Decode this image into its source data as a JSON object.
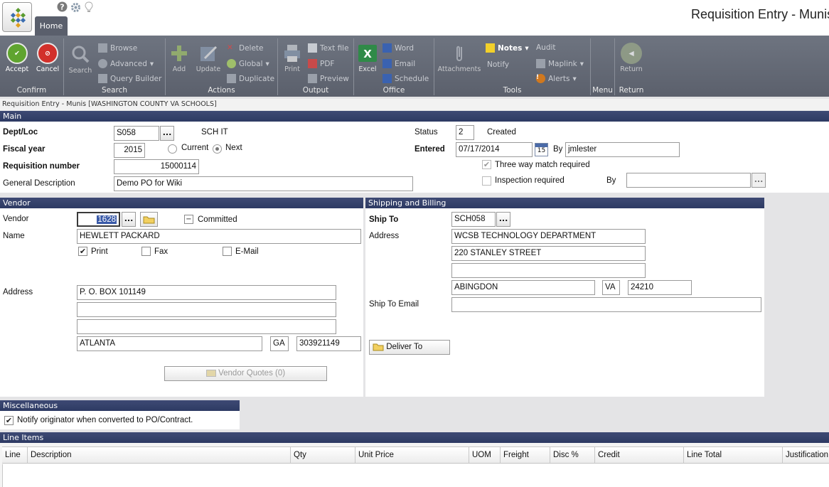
{
  "header": {
    "home_tab": "Home",
    "title": "Requisition Entry - Munis"
  },
  "ribbon": {
    "groups": [
      "Confirm",
      "Search",
      "Actions",
      "Output",
      "Office",
      "Tools",
      "Menu",
      "Return"
    ],
    "accept": "Accept",
    "cancel": "Cancel",
    "search": "Search",
    "browse": "Browse",
    "advanced": "Advanced",
    "query_builder": "Query Builder",
    "add": "Add",
    "update": "Update",
    "delete": "Delete",
    "global": "Global",
    "duplicate": "Duplicate",
    "print": "Print",
    "text_file": "Text file",
    "pdf": "PDF",
    "preview": "Preview",
    "excel": "Excel",
    "word": "Word",
    "email": "Email",
    "schedule": "Schedule",
    "attachments": "Attachments",
    "notes": "Notes",
    "notify": "Notify",
    "audit": "Audit",
    "maplink": "Maplink",
    "alerts": "Alerts",
    "return": "Return"
  },
  "breadcrumb": "Requisition Entry - Munis [WASHINGTON COUNTY VA SCHOOLS]",
  "main": {
    "title": "Main",
    "dept_loc_label": "Dept/Loc",
    "dept_loc_value": "S058",
    "dept_loc_desc": "SCH IT",
    "fiscal_year_label": "Fiscal year",
    "fiscal_year_value": "2015",
    "current_label": "Current",
    "next_label": "Next",
    "selected_year": "Next",
    "req_number_label": "Requisition number",
    "req_number_value": "15000114",
    "gen_desc_label": "General Description",
    "gen_desc_value": "Demo PO for Wiki",
    "status_label": "Status",
    "status_code": "2",
    "status_text": "Created",
    "entered_label": "Entered",
    "entered_date": "07/17/2014",
    "calendar_day": "15",
    "by_label": "By",
    "by_value": "jmlester",
    "three_way_label": "Three way match required",
    "three_way_checked": true,
    "inspection_label": "Inspection required",
    "inspection_checked": false,
    "inspection_by_label": "By",
    "inspection_by_value": ""
  },
  "vendor": {
    "title": "Vendor",
    "vendor_label": "Vendor",
    "vendor_value": "1628",
    "committed_label": "Committed",
    "name_label": "Name",
    "name_value": "HEWLETT PACKARD",
    "print_label": "Print",
    "print_checked": true,
    "fax_label": "Fax",
    "fax_checked": false,
    "email_label": "E-Mail",
    "email_checked": false,
    "address_label": "Address",
    "address1": "P. O. BOX 101149",
    "address2": "",
    "address3": "",
    "city": "ATLANTA",
    "state": "GA",
    "zip": "303921149",
    "quotes_button": "Vendor Quotes (0)"
  },
  "shipping": {
    "title": "Shipping and Billing",
    "ship_to_label": "Ship To",
    "ship_to_value": "SCH058",
    "address_label": "Address",
    "address1": "WCSB TECHNOLOGY DEPARTMENT",
    "address2": "220 STANLEY STREET",
    "address3": "",
    "city": "ABINGDON",
    "state": "VA",
    "zip": "24210",
    "email_label": "Ship To Email",
    "email_value": "",
    "deliver_button": "Deliver To"
  },
  "misc": {
    "title": "Miscellaneous",
    "notify_label": "Notify originator when converted to PO/Contract.",
    "notify_checked": true
  },
  "line_items": {
    "title": "Line Items",
    "columns": [
      "Line",
      "Description",
      "Qty",
      "Unit Price",
      "UOM",
      "Freight",
      "Disc %",
      "Credit",
      "Line Total",
      "Justification"
    ]
  },
  "colors": {
    "panel_header": "#2f3b66",
    "ribbon": "#636874",
    "accept_green": "#5fa42f",
    "cancel_red": "#d2302b"
  }
}
